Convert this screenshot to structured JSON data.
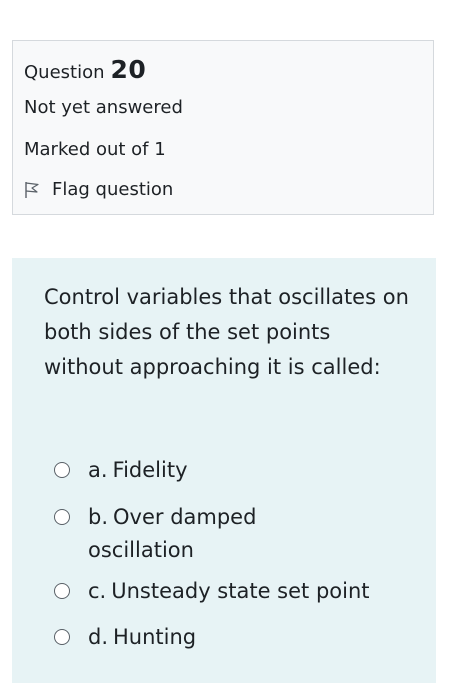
{
  "question_info": {
    "label": "Question",
    "number": "20",
    "state": "Not yet answered",
    "grade": "Marked out of 1",
    "flag_label": "Flag question"
  },
  "question": {
    "text": "Control variables that oscillates on both sides of the set points without approaching it is called:",
    "options": [
      {
        "letter": "a.",
        "text": "Fidelity"
      },
      {
        "letter": "b.",
        "text": "Over damped oscillation"
      },
      {
        "letter": "c.",
        "text": "Unsteady state set point"
      },
      {
        "letter": "d.",
        "text": "Hunting"
      }
    ]
  },
  "colors": {
    "info_background": "#f8f9fa",
    "info_border": "#d5d9dd",
    "content_background": "#e7f3f5",
    "text": "#1d2125"
  }
}
